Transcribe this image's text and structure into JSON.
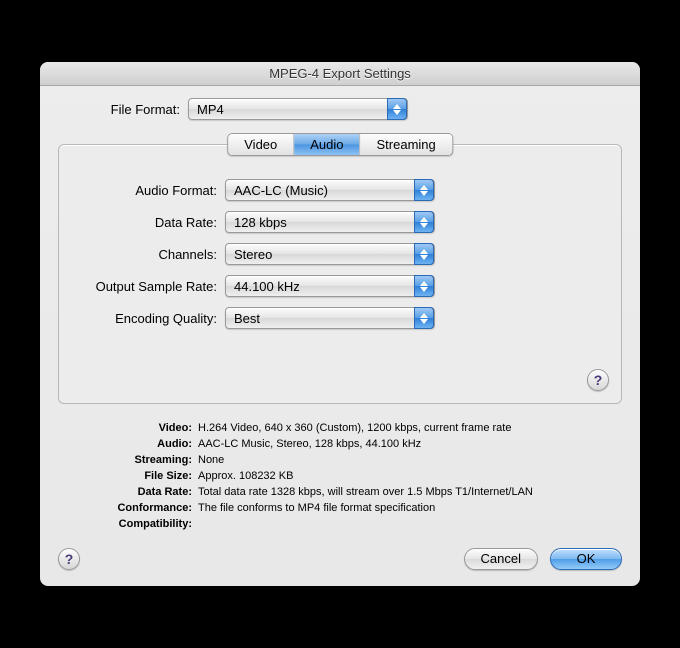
{
  "window": {
    "title": "MPEG-4 Export Settings"
  },
  "fileFormat": {
    "label": "File Format:",
    "value": "MP4"
  },
  "tabs": {
    "video": "Video",
    "audio": "Audio",
    "streaming": "Streaming",
    "active": "audio"
  },
  "audio": {
    "format": {
      "label": "Audio Format:",
      "value": "AAC-LC (Music)"
    },
    "dataRate": {
      "label": "Data Rate:",
      "value": "128 kbps"
    },
    "channels": {
      "label": "Channels:",
      "value": "Stereo"
    },
    "sampleRate": {
      "label": "Output Sample Rate:",
      "value": "44.100 kHz"
    },
    "quality": {
      "label": "Encoding Quality:",
      "value": "Best"
    }
  },
  "summary": {
    "video": {
      "label": "Video:",
      "value": "H.264 Video, 640 x 360 (Custom), 1200 kbps, current frame rate"
    },
    "audio": {
      "label": "Audio:",
      "value": "AAC-LC Music, Stereo, 128 kbps, 44.100 kHz"
    },
    "streaming": {
      "label": "Streaming:",
      "value": "None"
    },
    "fileSize": {
      "label": "File Size:",
      "value": "Approx. 108232 KB"
    },
    "dataRate": {
      "label": "Data Rate:",
      "value": "Total data rate 1328 kbps, will stream over 1.5 Mbps T1/Internet/LAN"
    },
    "conformance": {
      "label": "Conformance:",
      "value": "The file conforms to MP4 file format specification"
    },
    "compatibility": {
      "label": "Compatibility:",
      "value": ""
    }
  },
  "buttons": {
    "cancel": "Cancel",
    "ok": "OK",
    "help": "?"
  }
}
